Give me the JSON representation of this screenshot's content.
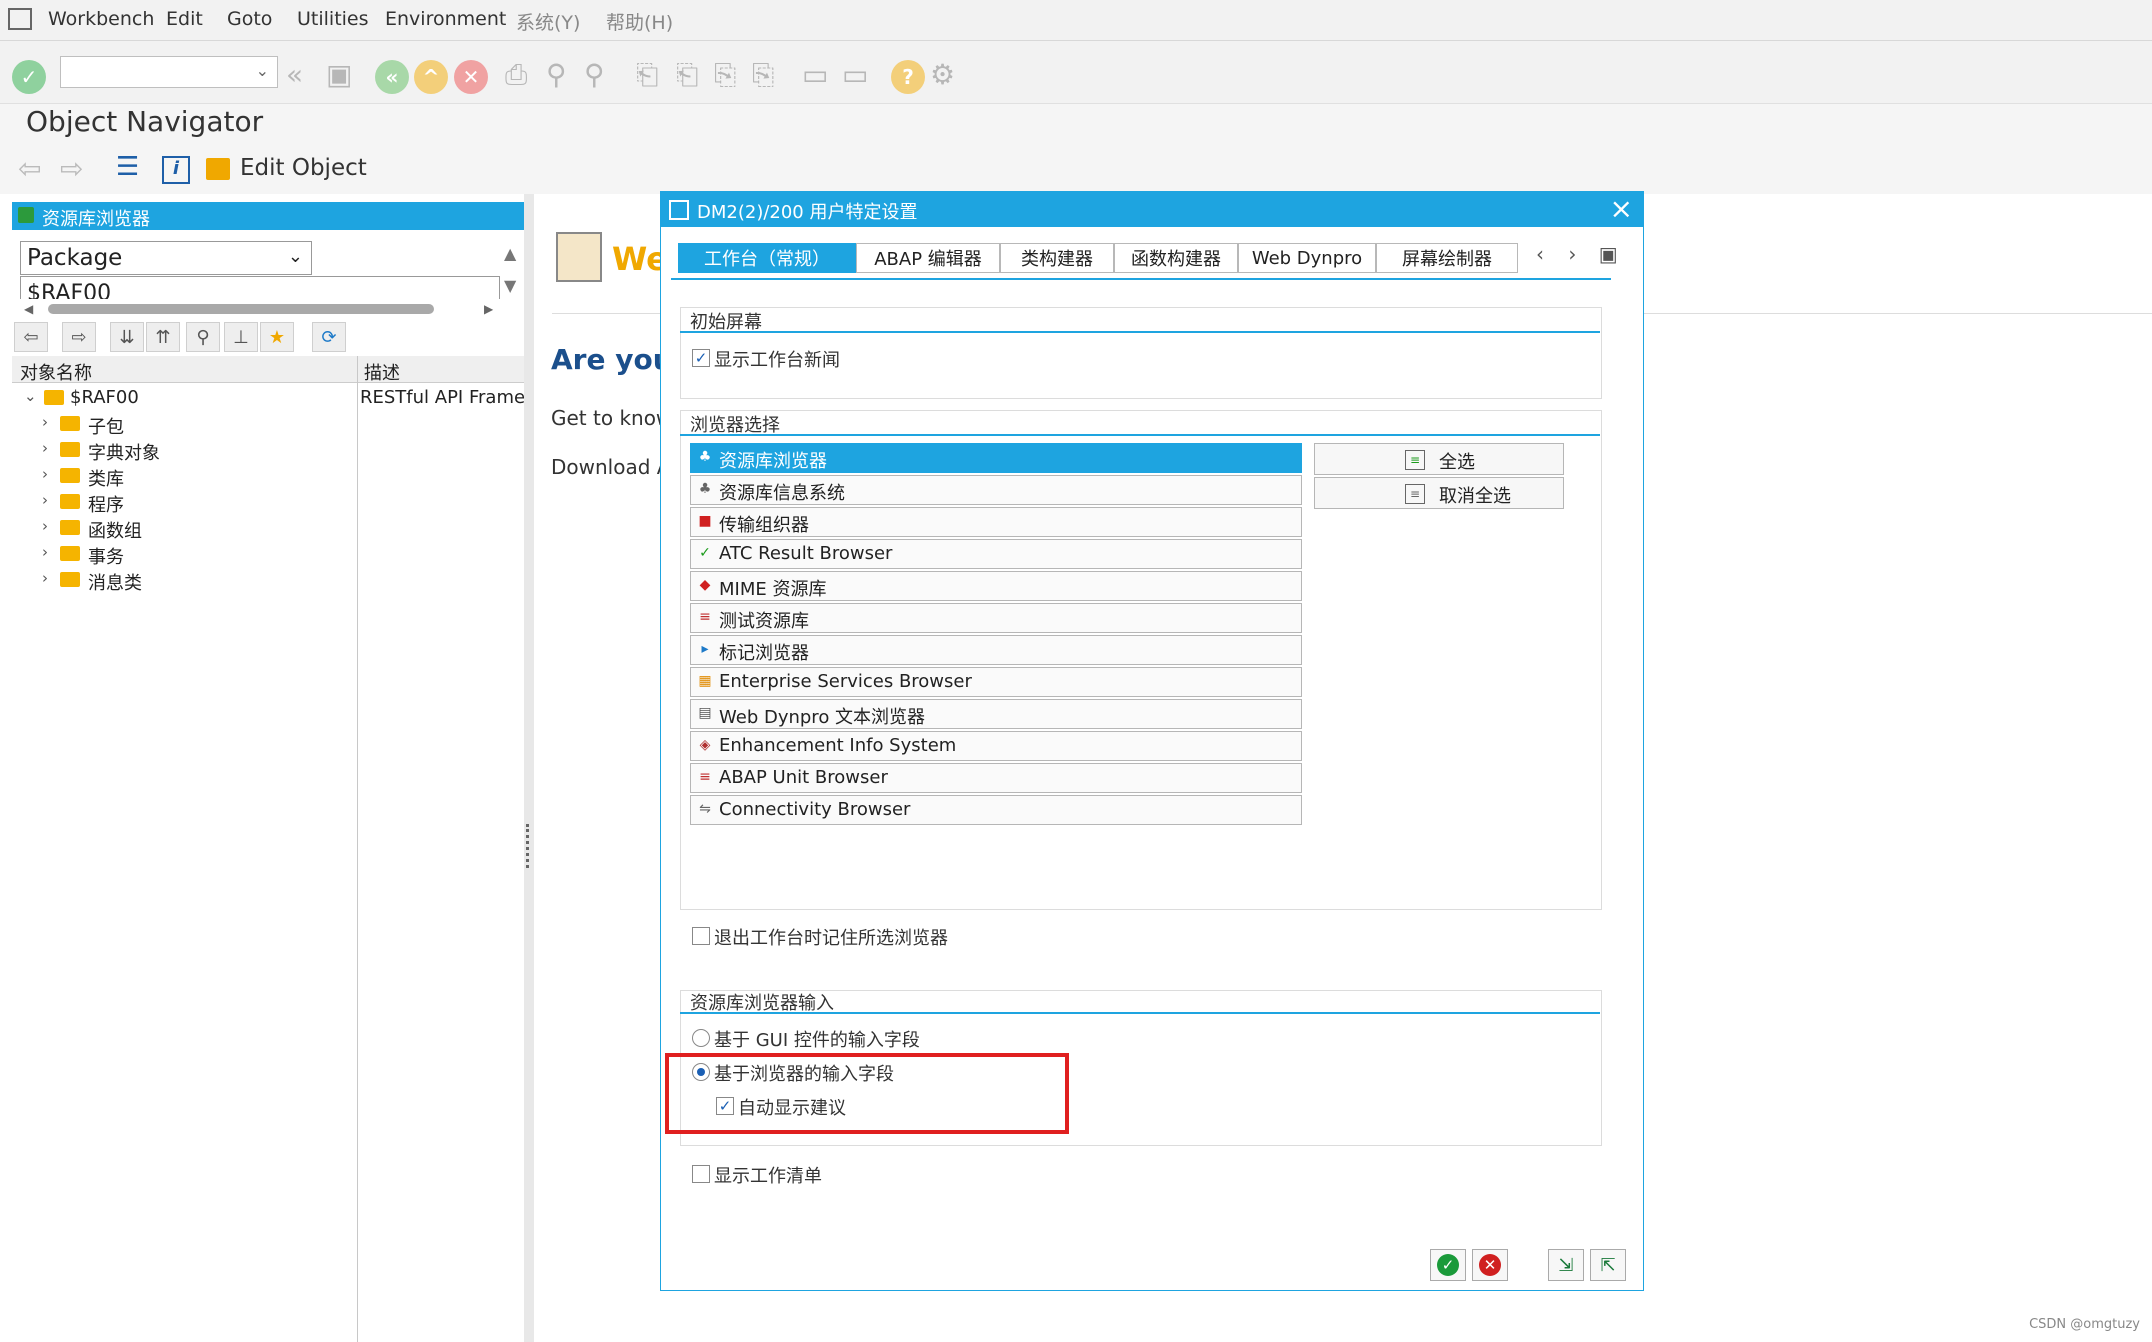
{
  "menu": {
    "workbench": "Workbench",
    "edit": "Edit",
    "goto": "Goto",
    "utilities": "Utilities",
    "environment": "Environment",
    "system": "系统(Y)",
    "help": "帮助(H)"
  },
  "page": {
    "title": "Object Navigator",
    "edit_object": "Edit Object"
  },
  "left_panel": {
    "header": "资源库浏览器",
    "object_type": "Package",
    "package_name": "$RAF00",
    "col_name": "对象名称",
    "col_desc": "描述",
    "tree": [
      {
        "label": "$RAF00",
        "desc": "RESTful API Framew"
      },
      {
        "label": "子包"
      },
      {
        "label": "字典对象"
      },
      {
        "label": "类库"
      },
      {
        "label": "程序"
      },
      {
        "label": "函数组"
      },
      {
        "label": "事务"
      },
      {
        "label": "消息类"
      }
    ]
  },
  "right_area": {
    "welcome_partial": "We",
    "heading_partial": "Are you",
    "line1_partial": "Get to know",
    "line2_partial": "Download A"
  },
  "dialog": {
    "title": "DM2(2)/200 用户特定设置",
    "tabs": [
      "工作台（常规）",
      "ABAP 编辑器",
      "类构建器",
      "函数构建器",
      "Web Dynpro",
      "屏幕绘制器"
    ],
    "initial_screen": {
      "title": "初始屏幕",
      "show_news": "显示工作台新闻",
      "show_news_checked": true
    },
    "browser_selection": {
      "title": "浏览器选择",
      "browsers": [
        "资源库浏览器",
        "资源库信息系统",
        "传输组织器",
        "ATC Result Browser",
        "MIME 资源库",
        "测试资源库",
        "标记浏览器",
        "Enterprise Services Browser",
        "Web Dynpro 文本浏览器",
        "Enhancement Info System",
        "ABAP Unit Browser",
        "Connectivity Browser"
      ],
      "select_all": "全选",
      "deselect_all": "取消全选"
    },
    "remember_on_exit": "退出工作台时记住所选浏览器",
    "repo_input": {
      "title": "资源库浏览器输入",
      "gui_option": "基于 GUI 控件的输入字段",
      "browser_option": "基于浏览器的输入字段",
      "auto_suggest": "自动显示建议",
      "auto_suggest_checked": true,
      "selected": "browser"
    },
    "show_worklist": "显示工作清单"
  },
  "colors": {
    "accent": "#1ea4e0",
    "highlight_box": "#e02020"
  },
  "watermark": "CSDN @omgtuzy"
}
